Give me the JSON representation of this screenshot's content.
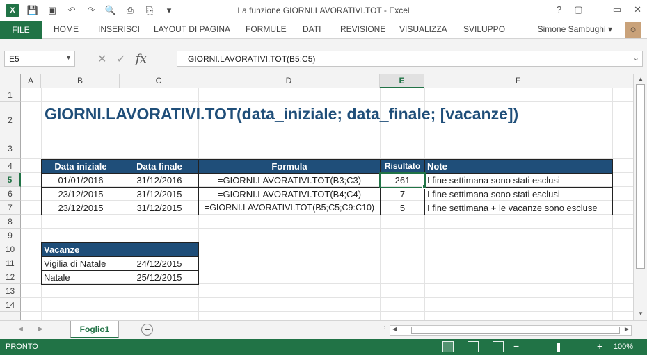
{
  "window": {
    "title": "La funzione GIORNI.LAVORATIVI.TOT - Excel",
    "controls": [
      "?",
      "▢",
      "–",
      "▭",
      "✕"
    ]
  },
  "qat": {
    "icons": [
      "excel-logo",
      "save-icon",
      "save-as-icon",
      "undo-icon",
      "redo-icon",
      "print-preview-icon",
      "print-icon",
      "attach-icon",
      "more-icon"
    ]
  },
  "ribbon": {
    "file_tab": "FILE",
    "tabs": [
      "HOME",
      "INSERISCI",
      "LAYOUT DI PAGINA",
      "FORMULE",
      "DATI",
      "REVISIONE",
      "VISUALIZZA",
      "SVILUPPO"
    ],
    "user": "Simone Sambughi"
  },
  "formula_bar": {
    "name_box": "E5",
    "formula": "=GIORNI.LAVORATIVI.TOT(B5;C5)",
    "fx": "fx"
  },
  "sheet": {
    "columns": [
      "A",
      "B",
      "C",
      "D",
      "E",
      "F"
    ],
    "rows": [
      "1",
      "2",
      "3",
      "4",
      "5",
      "6",
      "7",
      "8",
      "9",
      "10",
      "11",
      "12",
      "13",
      "14"
    ],
    "title": "GIORNI.LAVORATIVI.TOT(data_iniziale; data_finale; [vacanze])",
    "table_headers": [
      "Data iniziale",
      "Data finale",
      "Formula",
      "Risultato",
      "Note"
    ],
    "table_rows": [
      [
        "01/01/2016",
        "31/12/2016",
        "=GIORNI.LAVORATIVI.TOT(B3;C3)",
        "261",
        "I fine settimana sono stati esclusi"
      ],
      [
        "23/12/2015",
        "31/12/2015",
        "=GIORNI.LAVORATIVI.TOT(B4;C4)",
        "7",
        "I fine settimana sono stati esclusi"
      ],
      [
        "23/12/2015",
        "31/12/2015",
        "=GIORNI.LAVORATIVI.TOT(B5;C5;C9:C10)",
        "5",
        "I fine settimana + le vacanze sono escluse"
      ]
    ],
    "holidays_header": "Vacanze",
    "holidays": [
      [
        "Vigilia di Natale",
        "24/12/2015"
      ],
      [
        "Natale",
        "25/12/2015"
      ]
    ]
  },
  "sheet_tabs": {
    "active": "Foglio1",
    "add": "+"
  },
  "status": {
    "text": "PRONTO",
    "zoom": "100%",
    "zoom_minus": "−",
    "zoom_plus": "+"
  },
  "colors": {
    "accent": "#217346",
    "header_fill": "#1f4e79",
    "title_text": "#1f4e79"
  }
}
